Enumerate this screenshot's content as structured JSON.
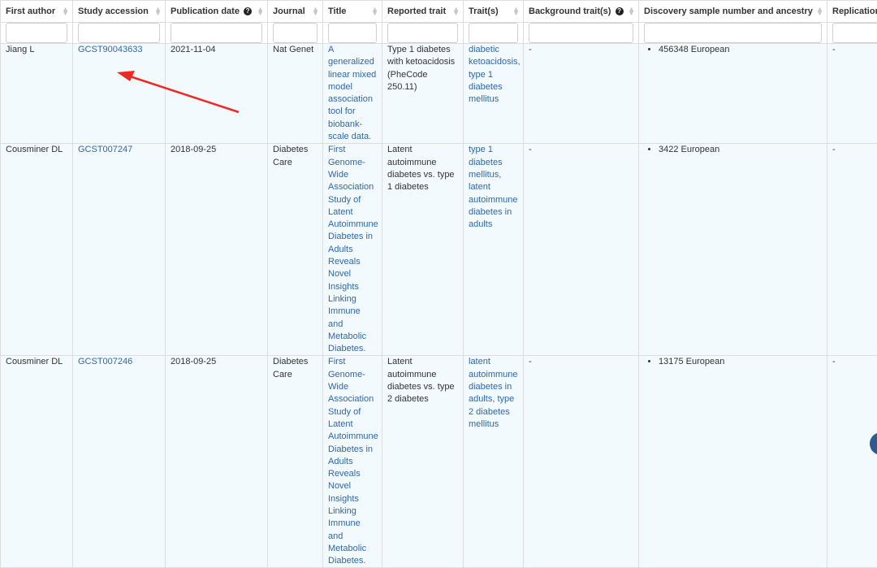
{
  "table": {
    "columns": [
      {
        "key": "first_author",
        "label": "First author",
        "help": false
      },
      {
        "key": "study_accession",
        "label": "Study accession",
        "help": false
      },
      {
        "key": "publication_date",
        "label": "Publication date",
        "help": true
      },
      {
        "key": "journal",
        "label": "Journal",
        "help": false
      },
      {
        "key": "title",
        "label": "Title",
        "help": false
      },
      {
        "key": "reported_trait",
        "label": "Reported trait",
        "help": false
      },
      {
        "key": "traits",
        "label": "Trait(s)",
        "help": false
      },
      {
        "key": "background_traits",
        "label": "Background trait(s)",
        "help": true
      },
      {
        "key": "discovery_sample",
        "label": "Discovery sample number and ancestry",
        "help": false
      },
      {
        "key": "replication",
        "label": "Replication",
        "help": false
      }
    ],
    "rows": [
      {
        "first_author": "Jiang L",
        "study_accession": "GCST90043633",
        "publication_date": "2021-11-04",
        "journal": "Nat Genet",
        "title": "A generalized linear mixed model association tool for biobank-scale data.",
        "reported_trait": "Type 1 diabetes with ketoacidosis (PheCode 250.11)",
        "traits": "diabetic ketoacidosis, type 1 diabetes mellitus",
        "background_traits": "-",
        "discovery_sample": "456348 European",
        "replication": "-"
      },
      {
        "first_author": "Cousminer DL",
        "study_accession": "GCST007247",
        "publication_date": "2018-09-25",
        "journal": "Diabetes Care",
        "title": "First Genome-Wide Association Study of Latent Autoimmune Diabetes in Adults Reveals Novel Insights Linking Immune and Metabolic Diabetes.",
        "reported_trait": "Latent autoimmune diabetes vs. type 1 diabetes",
        "traits": "type 1 diabetes mellitus, latent autoimmune diabetes in adults",
        "background_traits": "-",
        "discovery_sample": "3422 European",
        "replication": "-"
      },
      {
        "first_author": "Cousminer DL",
        "study_accession": "GCST007246",
        "publication_date": "2018-09-25",
        "journal": "Diabetes Care",
        "title": "First Genome-Wide Association Study of Latent Autoimmune Diabetes in Adults Reveals Novel Insights Linking Immune and Metabolic Diabetes.",
        "reported_trait": "Latent autoimmune diabetes vs. type 2 diabetes",
        "traits": "latent autoimmune diabetes in adults, type 2 diabetes mellitus",
        "background_traits": "-",
        "discovery_sample": "13175 European",
        "replication": "-"
      }
    ]
  },
  "icons": {
    "sort": "sort-icon",
    "help": "question-circle-icon",
    "annotation": "red-arrow",
    "scroll": "scroll-button"
  },
  "colors": {
    "link": "#2f67a8",
    "row_background": "#f3fafd",
    "annotation_arrow": "#ee2a24",
    "border": "#dddddd"
  }
}
